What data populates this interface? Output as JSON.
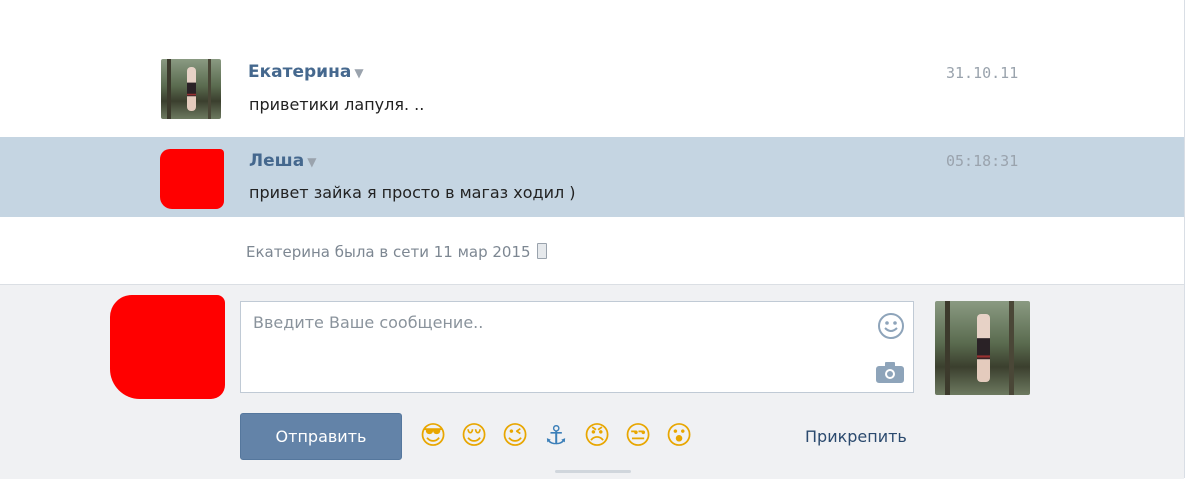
{
  "messages": [
    {
      "author": "Екатерина",
      "text": "приветики лапуля. ..",
      "time": "31.10.11",
      "avatar": "photo-avatar"
    },
    {
      "author": "Леша",
      "text": "привет зайка я просто в магаз ходил )",
      "time": "05:18:31",
      "avatar": "redacted-avatar",
      "highlighted": true
    }
  ],
  "status": {
    "text": "Екатерина была в сети 11 мар 2015",
    "icon": "mobile-phone-icon"
  },
  "compose": {
    "placeholder": "Введите Ваше сообщение..",
    "value": "",
    "send_label": "Отправить",
    "attach_label": "Прикрепить",
    "emoji_icons": [
      "sunglasses-face-icon",
      "relieved-face-icon",
      "winking-face-icon",
      "anchor-icon",
      "angry-face-icon",
      "unamused-face-icon",
      "surprised-face-icon"
    ],
    "emoji_glyphs": [
      "😎",
      "😌",
      "😉",
      "⚓",
      "😠",
      "😒",
      "😮"
    ]
  },
  "colors": {
    "author_link": "#45688e",
    "highlight_row": "#c5d5e2",
    "send_button": "#6383a8",
    "redaction": "#ff0000"
  }
}
